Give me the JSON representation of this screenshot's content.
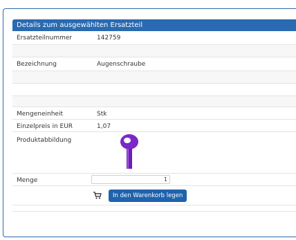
{
  "panel": {
    "title": "Details zum ausgewählten Ersatzteil"
  },
  "details": {
    "part_number_label": "Ersatzteilnummer",
    "part_number_value": "142759",
    "designation_label": "Bezeichnung",
    "designation_value": "Augenschraube",
    "unit_label": "Mengeneinheit",
    "unit_value": "Stk",
    "price_label": "Einzelpreis in EUR",
    "price_value": "1,07",
    "image_label": "Produktabbildung"
  },
  "order": {
    "quantity_label": "Menge",
    "quantity_value": "1",
    "add_to_cart_label": "In den Warenkorb legen",
    "cart_icon": "shopping-cart-icon",
    "button_color": "#1f63ad"
  },
  "theme": {
    "header_color": "#2a6ab0",
    "product_color": "#7b28c8"
  }
}
